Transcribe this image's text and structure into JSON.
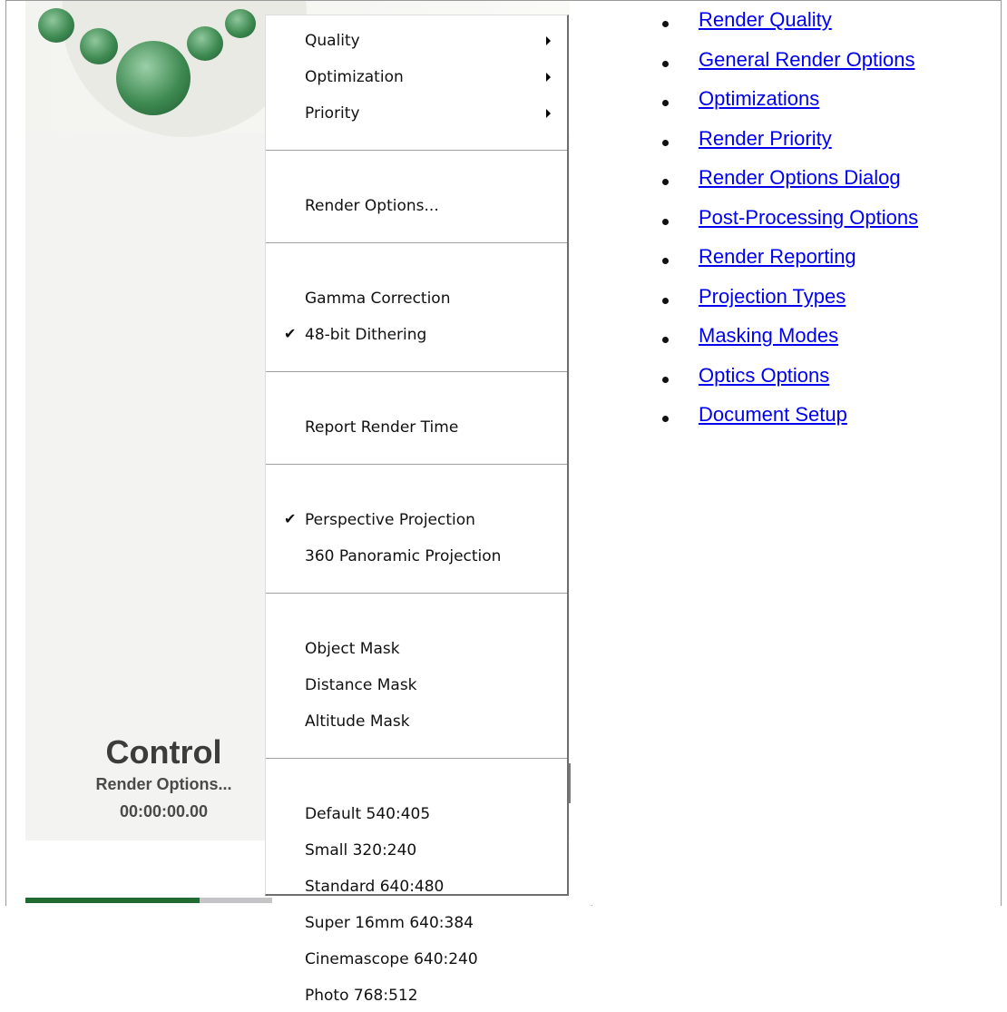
{
  "control_panel": {
    "title": "Control",
    "subtitle": "Render Options...",
    "time": "00:00:00.00"
  },
  "context_menu": {
    "groups": [
      [
        {
          "label": "Quality",
          "submenu": true,
          "checked": false
        },
        {
          "label": "Optimization",
          "submenu": true,
          "checked": false
        },
        {
          "label": "Priority",
          "submenu": true,
          "checked": false
        }
      ],
      [
        {
          "label": "Render Options...",
          "submenu": false,
          "checked": false
        }
      ],
      [
        {
          "label": "Gamma Correction",
          "submenu": false,
          "checked": false
        },
        {
          "label": "48-bit Dithering",
          "submenu": false,
          "checked": true
        }
      ],
      [
        {
          "label": "Report Render Time",
          "submenu": false,
          "checked": false
        }
      ],
      [
        {
          "label": "Perspective Projection",
          "submenu": false,
          "checked": true
        },
        {
          "label": "360 Panoramic Projection",
          "submenu": false,
          "checked": false
        }
      ],
      [
        {
          "label": "Object Mask",
          "submenu": false,
          "checked": false
        },
        {
          "label": "Distance Mask",
          "submenu": false,
          "checked": false
        },
        {
          "label": "Altitude Mask",
          "submenu": false,
          "checked": false
        }
      ],
      [
        {
          "label": "Default 540:405",
          "submenu": false,
          "checked": false
        },
        {
          "label": "Small 320:240",
          "submenu": false,
          "checked": false
        },
        {
          "label": "Standard 640:480",
          "submenu": false,
          "checked": false
        },
        {
          "label": "Super 16mm 640:384",
          "submenu": false,
          "checked": false
        },
        {
          "label": "Cinemascope 640:240",
          "submenu": false,
          "checked": false
        },
        {
          "label": "Photo 768:512",
          "submenu": false,
          "checked": false
        }
      ]
    ]
  },
  "links": [
    "Render Quality",
    "General Render Options",
    "Optimizations",
    "Render Priority",
    "Render Options Dialog",
    "Post-Processing Options",
    "Render Reporting",
    "Projection Types",
    "Masking Modes",
    "Optics Options",
    "Document Setup"
  ],
  "colors": {
    "link": "#0000ee",
    "brand_green": "#1f6b32",
    "sphere_green": "#3f8a52"
  },
  "icons": {
    "check": "checkmark-icon",
    "submenu": "submenu-arrow-icon",
    "bullet": "bullet-icon"
  }
}
